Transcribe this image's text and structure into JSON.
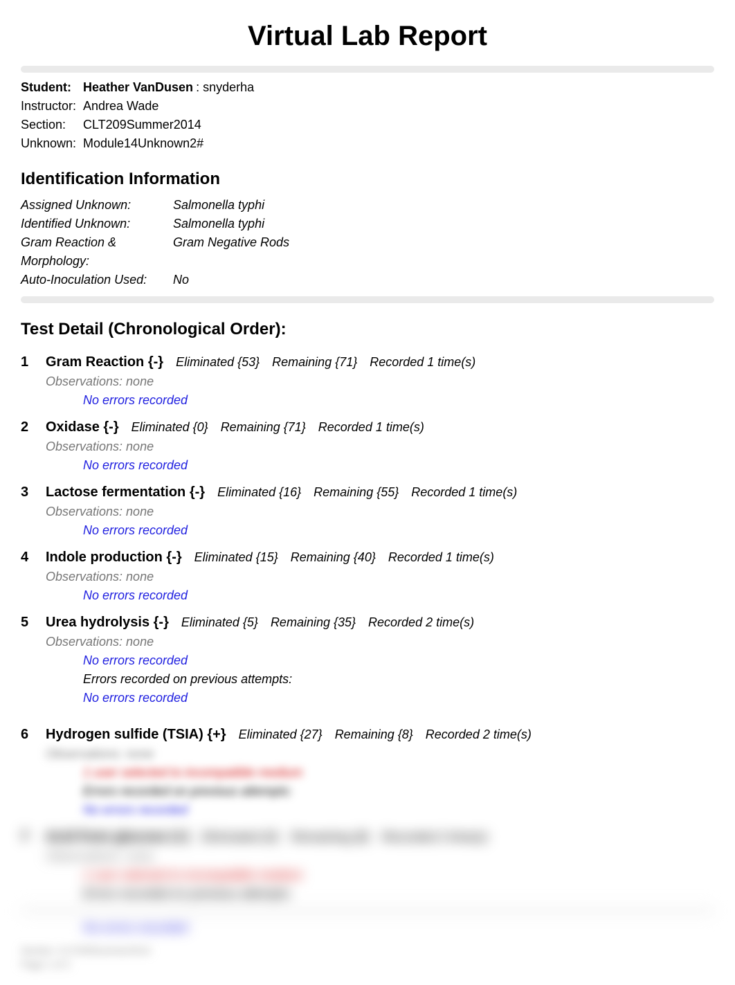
{
  "title": "Virtual Lab Report",
  "student": {
    "label": "Student:",
    "name": "Heather VanDusen",
    "suffix": ": snyderha"
  },
  "instructor": {
    "label": "Instructor:",
    "value": "Andrea Wade"
  },
  "section": {
    "label": "Section:",
    "value": "CLT209Summer2014"
  },
  "unknown": {
    "label": "Unknown:",
    "value": "Module14Unknown2#"
  },
  "identHeader": "Identification Information",
  "ident": {
    "assigned": {
      "label": "Assigned Unknown:",
      "value": "Salmonella typhi"
    },
    "identified": {
      "label": "Identified Unknown:",
      "value": "Salmonella typhi"
    },
    "gram": {
      "label": "Gram Reaction & Morphology:",
      "value": "Gram Negative Rods"
    },
    "auto": {
      "label": "Auto-Inoculation Used:",
      "value": "No"
    }
  },
  "testHeader": "Test Detail (Chronological Order):",
  "noErrors": "No errors recorded",
  "prevAttempts": "Errors recorded on previous attempts:",
  "incompat": "1 user selected to incompatible medium",
  "obsNone": "Observations: none",
  "tests": [
    {
      "num": "1",
      "name": "Gram Reaction {-}",
      "elim": "Eliminated {53}",
      "rem": "Remaining {71}",
      "rec": "Recorded 1 time(s)"
    },
    {
      "num": "2",
      "name": "Oxidase {-}",
      "elim": "Eliminated {0}",
      "rem": "Remaining {71}",
      "rec": "Recorded 1 time(s)"
    },
    {
      "num": "3",
      "name": "Lactose fermentation {-}",
      "elim": "Eliminated {16}",
      "rem": "Remaining {55}",
      "rec": "Recorded 1 time(s)"
    },
    {
      "num": "4",
      "name": "Indole production {-}",
      "elim": "Eliminated {15}",
      "rem": "Remaining {40}",
      "rec": "Recorded 1 time(s)"
    },
    {
      "num": "5",
      "name": "Urea hydrolysis {-}",
      "elim": "Eliminated {5}",
      "rem": "Remaining {35}",
      "rec": "Recorded 2 time(s)"
    },
    {
      "num": "6",
      "name": "Hydrogen sulfide (TSIA) {+}",
      "elim": "Eliminated {27}",
      "rem": "Remaining {8}",
      "rec": "Recorded 2 time(s)"
    },
    {
      "num": "7",
      "name": "Acid from glucose {+}",
      "elim": "Eliminated {0}",
      "rem": "Remaining {8}",
      "rec": "Recorded 2 time(s)"
    }
  ],
  "footer1": "Section: CLT209Summer2014",
  "footer2": "Page 1 of 2"
}
